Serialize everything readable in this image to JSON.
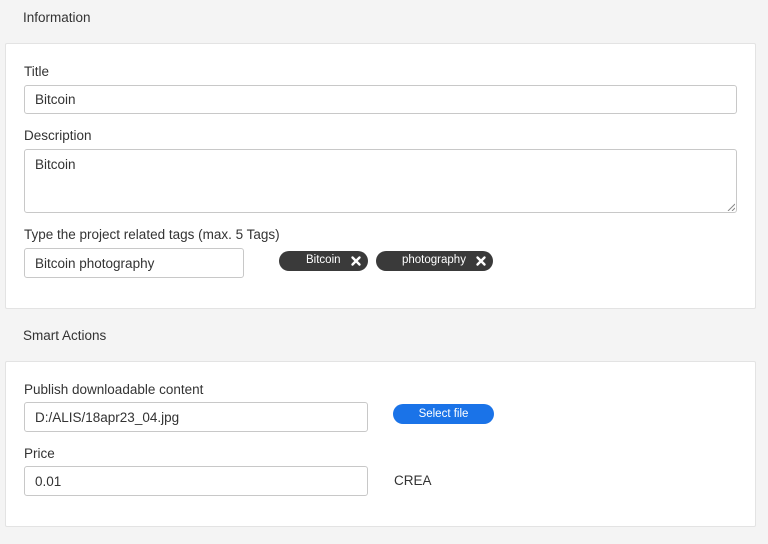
{
  "information": {
    "section_title": "Information",
    "title_label": "Title",
    "title_value": "Bitcoin",
    "description_label": "Description",
    "description_value": "Bitcoin",
    "tags_label": "Type the project related tags (max. 5 Tags)",
    "tags_input_value": "Bitcoin photography",
    "tags": [
      {
        "label": "Bitcoin",
        "remove_icon": "close-icon"
      },
      {
        "label": "photography",
        "remove_icon": "close-icon"
      }
    ]
  },
  "smart_actions": {
    "section_title": "Smart Actions",
    "download_label": "Publish downloadable content",
    "download_value": "D:/ALIS/18apr23_04.jpg",
    "select_file_label": "Select file",
    "price_label": "Price",
    "price_value": "0.01",
    "currency": "CREA"
  },
  "colors": {
    "page_bg": "#f4f4f4",
    "card_bg": "#ffffff",
    "tag_bg": "#3a3a3a",
    "primary_button": "#1a73e8"
  }
}
